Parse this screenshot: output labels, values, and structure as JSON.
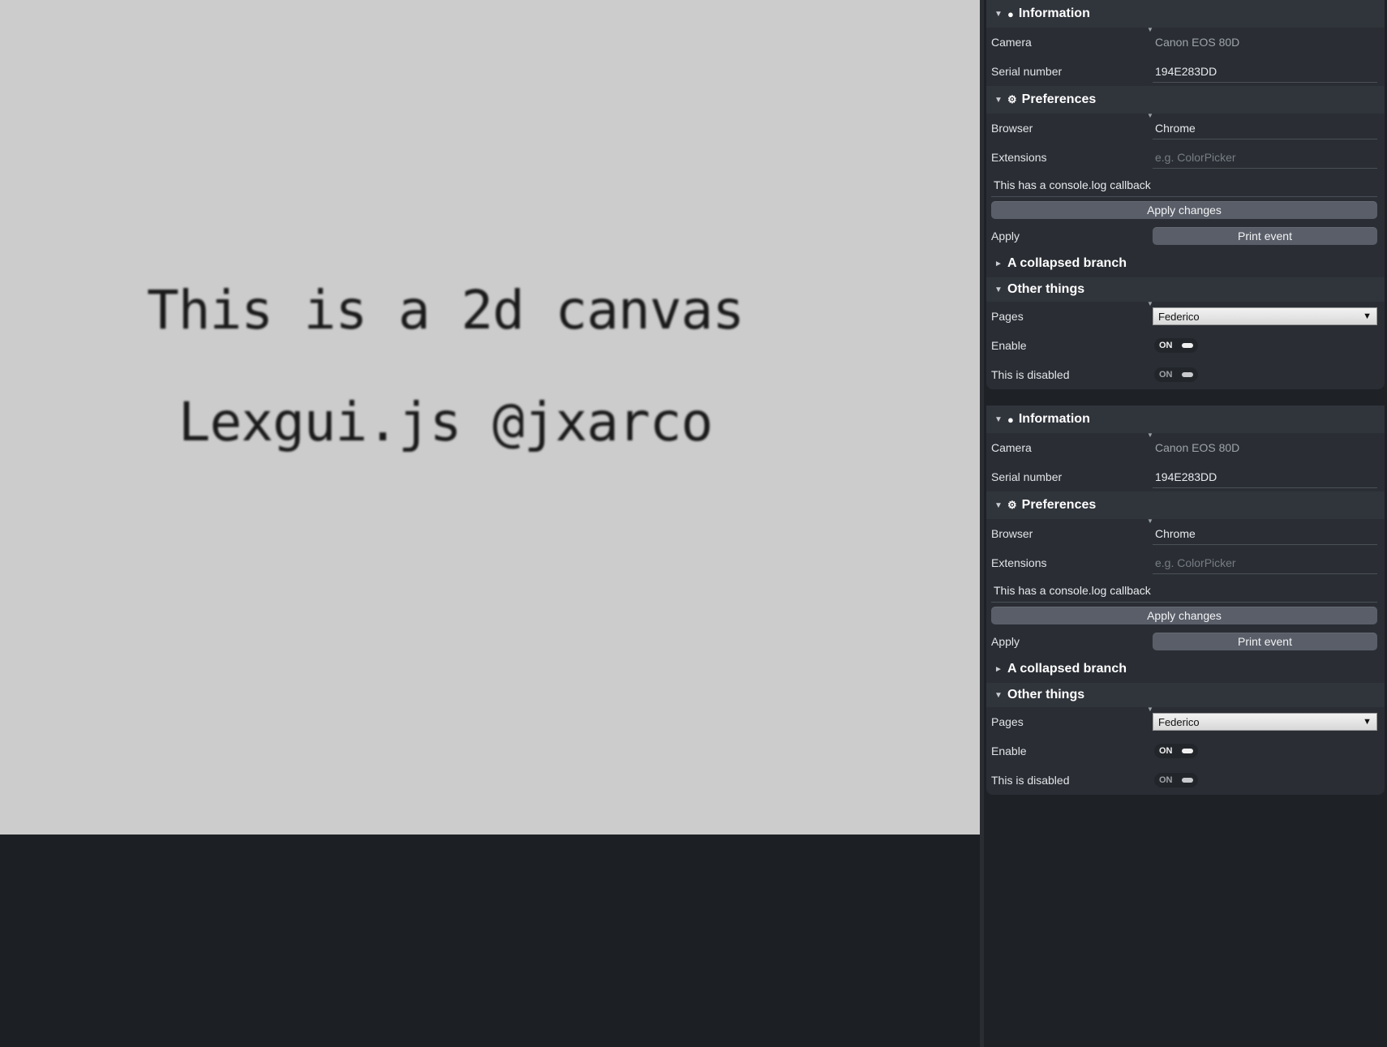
{
  "canvas": {
    "line1": "This is a 2d canvas",
    "line2": "Lexgui.js @jxarco"
  },
  "panels": [
    {
      "information": {
        "title": "Information",
        "icon": "circle-icon",
        "camera_label": "Camera",
        "camera_value": "Canon EOS 80D",
        "serial_label": "Serial number",
        "serial_value": "194E283DD"
      },
      "preferences": {
        "title": "Preferences",
        "icon": "gear-icon",
        "browser_label": "Browser",
        "browser_value": "Chrome",
        "extensions_label": "Extensions",
        "extensions_placeholder": "e.g. ColorPicker",
        "callback_text": "This has a console.log callback",
        "apply_changes_label": "Apply changes",
        "apply_label": "Apply",
        "print_event_label": "Print event"
      },
      "collapsed_branch": {
        "title": "A collapsed branch"
      },
      "other_things": {
        "title": "Other things",
        "pages_label": "Pages",
        "pages_value": "Federico",
        "enable_label": "Enable",
        "enable_state": "ON",
        "disabled_label": "This is disabled",
        "disabled_state": "ON"
      }
    },
    {
      "information": {
        "title": "Information",
        "icon": "circle-icon",
        "camera_label": "Camera",
        "camera_value": "Canon EOS 80D",
        "serial_label": "Serial number",
        "serial_value": "194E283DD"
      },
      "preferences": {
        "title": "Preferences",
        "icon": "gear-icon",
        "browser_label": "Browser",
        "browser_value": "Chrome",
        "extensions_label": "Extensions",
        "extensions_placeholder": "e.g. ColorPicker",
        "callback_text": "This has a console.log callback",
        "apply_changes_label": "Apply changes",
        "apply_label": "Apply",
        "print_event_label": "Print event"
      },
      "collapsed_branch": {
        "title": "A collapsed branch"
      },
      "other_things": {
        "title": "Other things",
        "pages_label": "Pages",
        "pages_value": "Federico",
        "enable_label": "Enable",
        "enable_state": "ON",
        "disabled_label": "This is disabled",
        "disabled_state": "ON"
      }
    }
  ],
  "colors": {
    "canvas_background": "#cccccc",
    "panel_background": "#2a2e34",
    "header_background": "#30343b",
    "button_background": "#595e68"
  }
}
